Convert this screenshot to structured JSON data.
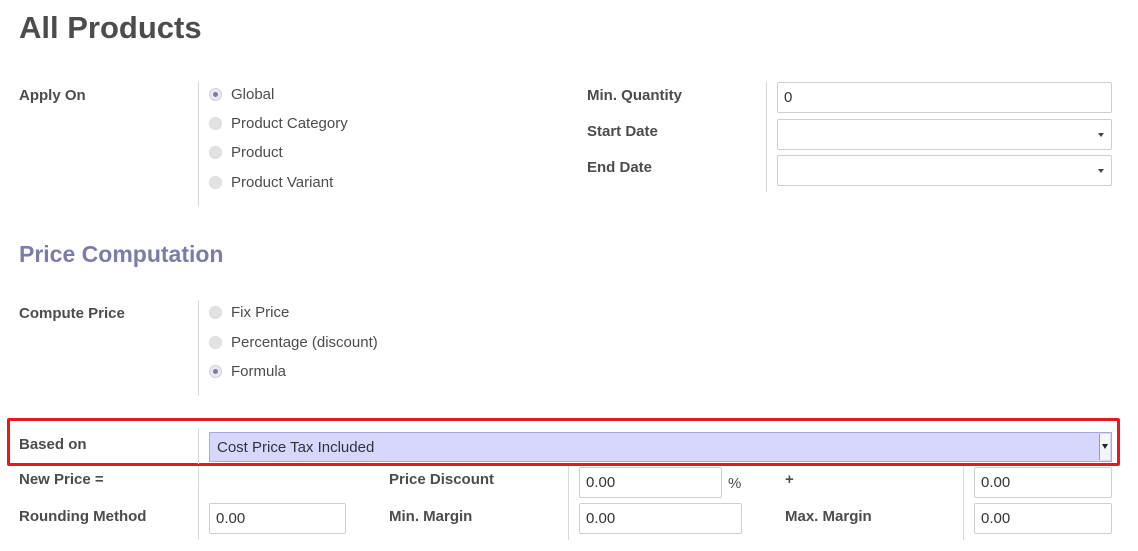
{
  "page": {
    "title": "All Products"
  },
  "apply_on": {
    "label": "Apply On",
    "options": [
      {
        "label": "Global",
        "checked": true
      },
      {
        "label": "Product Category",
        "checked": false
      },
      {
        "label": "Product",
        "checked": false
      },
      {
        "label": "Product Variant",
        "checked": false
      }
    ]
  },
  "conditions": {
    "min_quantity": {
      "label": "Min. Quantity",
      "value": "0"
    },
    "start_date": {
      "label": "Start Date",
      "value": ""
    },
    "end_date": {
      "label": "End Date",
      "value": ""
    }
  },
  "price_computation": {
    "title": "Price Computation",
    "compute_price": {
      "label": "Compute Price",
      "options": [
        {
          "label": "Fix Price",
          "checked": false
        },
        {
          "label": "Percentage (discount)",
          "checked": false
        },
        {
          "label": "Formula",
          "checked": true
        }
      ]
    },
    "based_on": {
      "label": "Based on",
      "value": "Cost Price Tax Included"
    },
    "new_price": {
      "label": "New Price ="
    },
    "price_discount": {
      "label": "Price Discount",
      "value": "0.00",
      "unit": "%"
    },
    "surcharge": {
      "symbol": "+",
      "value": "0.00"
    },
    "rounding_method": {
      "label": "Rounding Method",
      "value": "0.00"
    },
    "min_margin": {
      "label": "Min. Margin",
      "value": "0.00"
    },
    "max_margin": {
      "label": "Max. Margin",
      "value": "0.00"
    }
  },
  "colors": {
    "accent": "#7c7bad",
    "highlight_border": "#e31b1b",
    "select_bg": "#d7d6fd"
  }
}
